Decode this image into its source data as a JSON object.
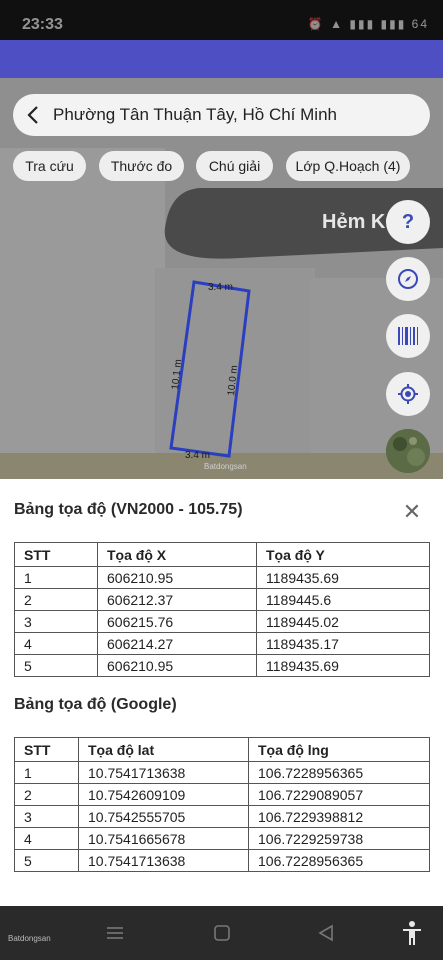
{
  "status": {
    "time": "23:33",
    "icons": "⏰ ▲ ▮▮▮ ▮▮▮ 64"
  },
  "search": {
    "location": "Phường Tân Thuận Tây, Hồ Chí Minh"
  },
  "chips": [
    "Tra cứu",
    "Thước đo",
    "Chú giải",
    "Lớp Q.Hoạch (4)"
  ],
  "map": {
    "street_label": "Hẻm K6/",
    "edge_top": "3.4 m",
    "edge_left": "10.1 m",
    "edge_right": "10.0 m",
    "edge_bottom": "3.4 m",
    "watermark": "Batdongsan"
  },
  "fabs": [
    "help-icon",
    "compass-icon",
    "barcode-icon",
    "location-icon",
    "satellite-icon"
  ],
  "vn2000": {
    "title": "Bảng tọa độ (VN2000 - 105.75)",
    "headers": [
      "STT",
      "Tọa độ X",
      "Tọa độ Y"
    ],
    "rows": [
      [
        "1",
        "606210.95",
        "1189435.69"
      ],
      [
        "2",
        "606212.37",
        "1189445.6"
      ],
      [
        "3",
        "606215.76",
        "1189445.02"
      ],
      [
        "4",
        "606214.27",
        "1189435.17"
      ],
      [
        "5",
        "606210.95",
        "1189435.69"
      ]
    ]
  },
  "google": {
    "title": "Bảng tọa độ (Google)",
    "headers": [
      "STT",
      "Tọa độ lat",
      "Tọa độ lng"
    ],
    "rows": [
      [
        "1",
        "10.7541713638",
        "106.7228956365"
      ],
      [
        "2",
        "10.7542609109",
        "106.7229089057"
      ],
      [
        "3",
        "10.7542555705",
        "106.7229398812"
      ],
      [
        "4",
        "10.7541665678",
        "106.7229259738"
      ],
      [
        "5",
        "10.7541713638",
        "106.7228956365"
      ]
    ]
  },
  "nav": {
    "logo": "Batdongsan"
  },
  "colors": {
    "app_bar": "#4f4fc4",
    "fab_icon": "#3b48b8",
    "parcel_outline": "#2a3fc0"
  }
}
